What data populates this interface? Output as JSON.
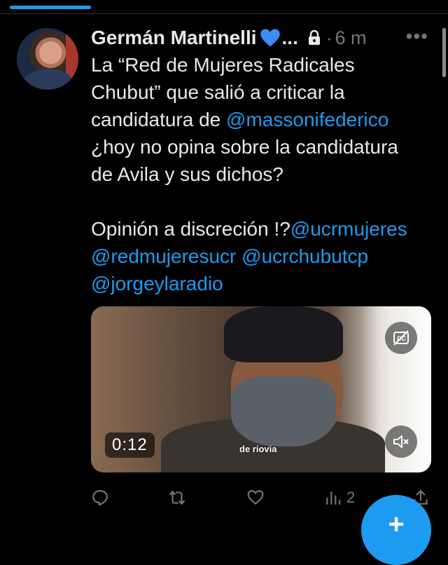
{
  "tweet": {
    "author_name": "Germán Martinelli",
    "name_emoji": "blue-heart-icon",
    "name_ellipsis": "...",
    "separator": "·",
    "time": "6 m",
    "more": "•••",
    "text_lines": [
      "La “Red de Mujeres Radicales",
      "Chubut” que salió a criticar la",
      "candidatura de "
    ],
    "mention_1": "@massonifederico",
    "text_line_4": "¿hoy no opina sobre la candidatura",
    "text_line_5": "de Avila y sus dichos?",
    "text_line_6": "Opinión a discreción !?",
    "mention_2": "@ucrmujeres",
    "mention_3": "@redmujeresucr",
    "mention_4": "@ucrchubutcp",
    "mention_5": "@jorgeylaradio"
  },
  "video": {
    "duration": "0:12",
    "caption": "de riovia"
  },
  "actions": {
    "views_count": "2"
  },
  "colors": {
    "background": "#000000",
    "text": "#e7e9ea",
    "secondary": "#71767b",
    "accent": "#1d9bf0"
  }
}
